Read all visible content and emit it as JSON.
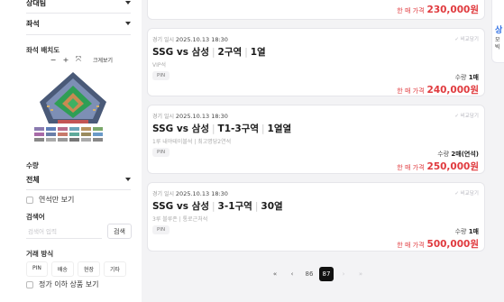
{
  "sidebar": {
    "top_select": "상대팀",
    "seat_select": "좌석",
    "seat_layout_label": "좌석 배치도",
    "zoom": {
      "minus": "−",
      "plus": "+",
      "reset": "⤧",
      "large_view": "크게보기"
    },
    "quantity_label": "수량",
    "quantity_value": "전체",
    "consecutive_only": "연석만 보기",
    "search_label": "검색어",
    "search_placeholder": "검색어 입력",
    "search_button": "검색",
    "method_label": "거래 방식",
    "methods": [
      "PIN",
      "배송",
      "현장",
      "기타"
    ],
    "below_price": "정가 이하 상품 보기"
  },
  "listings": [
    {
      "price_label": "한 매 가격",
      "price": "230,000원"
    },
    {
      "date_label": "경기 일시",
      "date": "2025.10.13 18:30",
      "compare": "비교담기",
      "match": "SSG vs 삼성",
      "section": "2구역",
      "row": "1열",
      "sub": "VIP석",
      "tag": "PIN",
      "qty_label": "수량",
      "qty": "1매",
      "price_label": "한 매 가격",
      "price": "240,000원"
    },
    {
      "date_label": "경기 일시",
      "date": "2025.10.13 18:30",
      "compare": "비교담기",
      "match": "SSG vs 삼성",
      "section": "T1-3구역",
      "row": "1열열",
      "sub": "1루 내야테이블석 | 최고명당2연석",
      "tag": "PIN",
      "qty_label": "수량",
      "qty": "2매(연석)",
      "price_label": "한 매 가격",
      "price": "250,000원"
    },
    {
      "date_label": "경기 일시",
      "date": "2025.10.13 18:30",
      "compare": "비교담기",
      "match": "SSG vs 삼성",
      "section": "3-1구역",
      "row": "30열",
      "sub": "3루 블루존 | 통로근처석",
      "tag": "PIN",
      "qty_label": "수량",
      "qty": "1매",
      "price_label": "한 매 가격",
      "price": "500,000원"
    }
  ],
  "pagination": {
    "first": "«",
    "prev": "‹",
    "page_prev": "86",
    "page_current": "87",
    "next": "›",
    "last": "»"
  },
  "right_panel": {
    "line1": "상",
    "line2": "모",
    "line3": "빅"
  },
  "colors": {
    "price": "#e03a3e",
    "active_page": "#111111",
    "accent_blue": "#2f6fe4"
  }
}
